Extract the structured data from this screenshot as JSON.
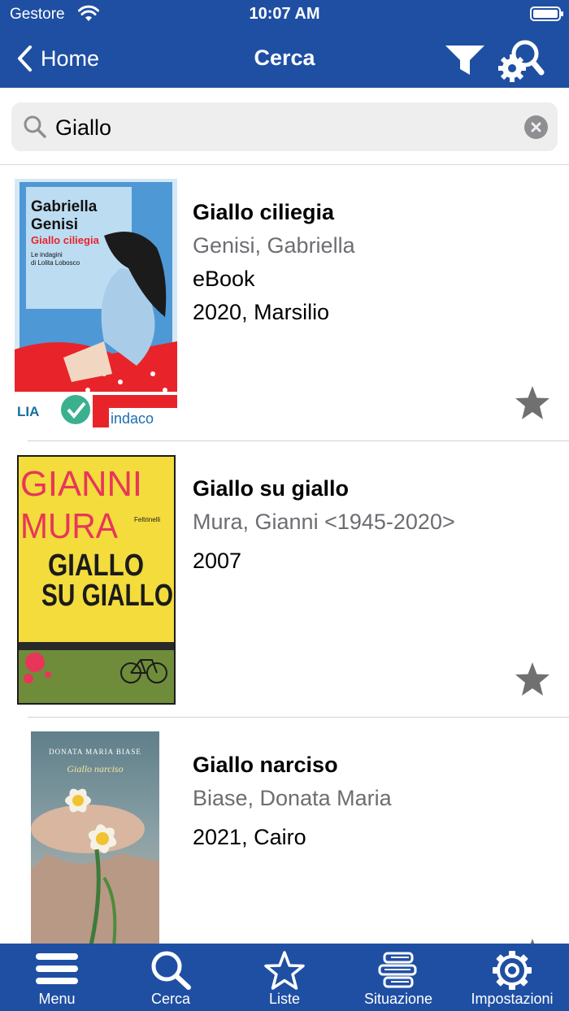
{
  "status_bar": {
    "carrier": "Gestore",
    "time": "10:07 AM"
  },
  "nav": {
    "back_label": "Home",
    "title": "Cerca"
  },
  "search": {
    "value": "Giallo",
    "placeholder": ""
  },
  "results": [
    {
      "title": "Giallo ciliegia",
      "author": "Genisi, Gabriella",
      "format": "eBook",
      "publication": "2020, Marsilio",
      "cover": {
        "line1": "Gabriella",
        "line2": "Genisi",
        "line3": "Giallo ciliegia",
        "line4": "Le indagini",
        "line5": "di Lolita Lobosco",
        "badge_left": "LIA",
        "badge_right": "indaco"
      }
    },
    {
      "title": "Giallo su giallo",
      "author": "Mura, Gianni <1945-2020>",
      "publication": "2007",
      "cover": {
        "line1": "GIANNI",
        "line2": "MURA",
        "line3": "GIALLO",
        "line4": "SU GIALLO",
        "publisher": "Feltrinelli"
      }
    },
    {
      "title": "Giallo narciso",
      "author": "Biase, Donata Maria",
      "publication": "2021, Cairo",
      "cover": {
        "line1": "DONATA MARIA BIASE",
        "line2": "Giallo narciso"
      }
    }
  ],
  "tabbar": [
    {
      "label": "Menu",
      "icon": "menu-icon"
    },
    {
      "label": "Cerca",
      "icon": "search-icon"
    },
    {
      "label": "Liste",
      "icon": "star-icon"
    },
    {
      "label": "Situazione",
      "icon": "books-icon"
    },
    {
      "label": "Impostazioni",
      "icon": "gear-icon"
    }
  ],
  "colors": {
    "brand": "#1f4fa3",
    "secondary_text": "#6d6d72",
    "star": "#707070"
  }
}
